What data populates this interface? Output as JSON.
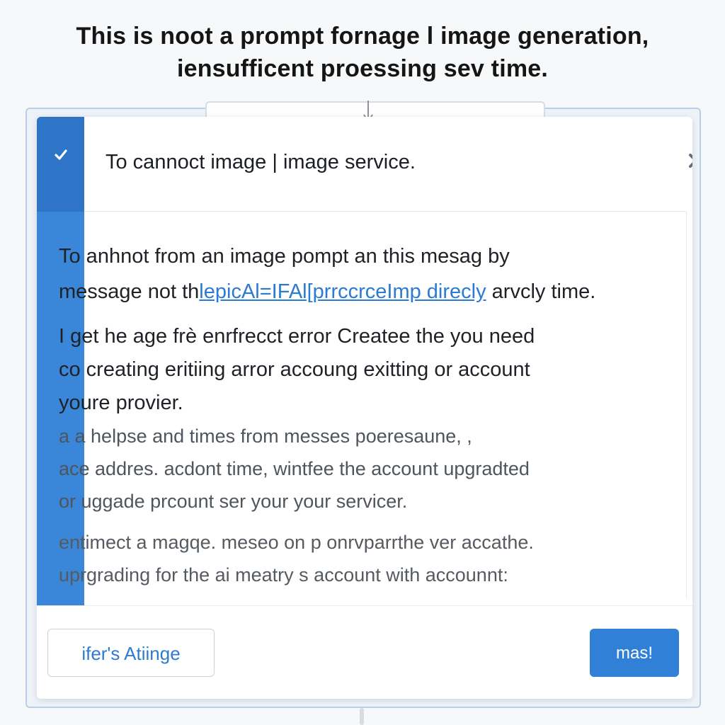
{
  "headline": {
    "line1": "This is noot a prompt fornage l image generation,",
    "line2": "iensufficent proessing sev time."
  },
  "dialog": {
    "title": "To cannoct image | image service.",
    "close_icon": "close-icon",
    "check_icon": "check-icon",
    "body": {
      "p1": [
        "To anhnot from an image pompt an this mesag by",
        {
          "before": "message not th",
          "link": "lepicAl=IFAl[prrccrceImp direcly",
          "after": " arvcly time."
        }
      ],
      "p2": [
        "I get  he age frè enrfrecct  error Createe the  you need",
        "co  creating eritiing  arror accoung exitting or  account",
        "youre provier."
      ],
      "p3": [
        "a a helpse and times from messes poeresaune,  ,",
        "ace addres. acdont  time,  wintfee the  account upgradted",
        "or uggade prcount  ser your  your servicer."
      ],
      "p4": [
        "entimect a  magqe. meseo on  p onrvparrthe ver accathe.",
        "uprgrading for the ai meatry s account with accounnt:"
      ]
    },
    "footer": {
      "secondary_label": "ifer's  Atiinge",
      "primary_label": "mas!"
    }
  },
  "colors": {
    "accent": "#3a86d8",
    "accent_dark": "#2f75c7",
    "primary_button": "#2f80d6",
    "link": "#2b7bd3"
  }
}
